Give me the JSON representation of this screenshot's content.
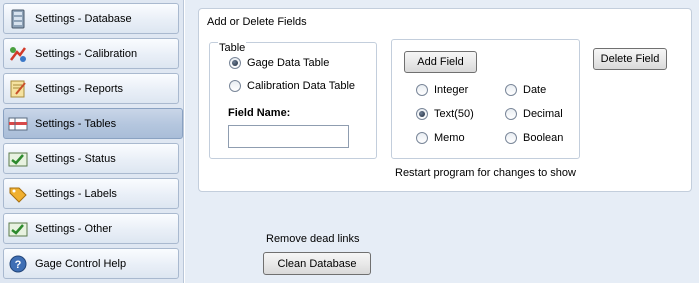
{
  "sidebar": {
    "items": [
      {
        "label": "Settings - Database",
        "icon": "database-icon"
      },
      {
        "label": "Settings - Calibration",
        "icon": "calibration-icon"
      },
      {
        "label": "Settings - Reports",
        "icon": "reports-icon"
      },
      {
        "label": "Settings - Tables",
        "icon": "tables-icon",
        "selected": true
      },
      {
        "label": "Settings - Status",
        "icon": "status-icon"
      },
      {
        "label": "Settings - Labels",
        "icon": "labels-icon"
      },
      {
        "label": "Settings - Other",
        "icon": "other-icon"
      },
      {
        "label": "Gage Control Help",
        "icon": "help-icon"
      }
    ]
  },
  "fields_group": {
    "title": "Add or Delete Fields",
    "table_box": {
      "title": "Table",
      "options": [
        {
          "label": "Gage Data Table",
          "checked": true
        },
        {
          "label": "Calibration Data Table",
          "checked": false
        }
      ],
      "field_name_label": "Field Name:",
      "field_name_value": ""
    },
    "type_box": {
      "add_button": "Add Field",
      "types": [
        {
          "label": "Integer",
          "checked": false
        },
        {
          "label": "Text(50)",
          "checked": true
        },
        {
          "label": "Memo",
          "checked": false
        },
        {
          "label": "Date",
          "checked": false
        },
        {
          "label": "Decimal",
          "checked": false
        },
        {
          "label": "Boolean",
          "checked": false
        }
      ]
    },
    "delete_button": "Delete Field",
    "restart_note": "Restart program for changes to show"
  },
  "cleanup": {
    "label": "Remove dead links",
    "button": "Clean Database"
  }
}
